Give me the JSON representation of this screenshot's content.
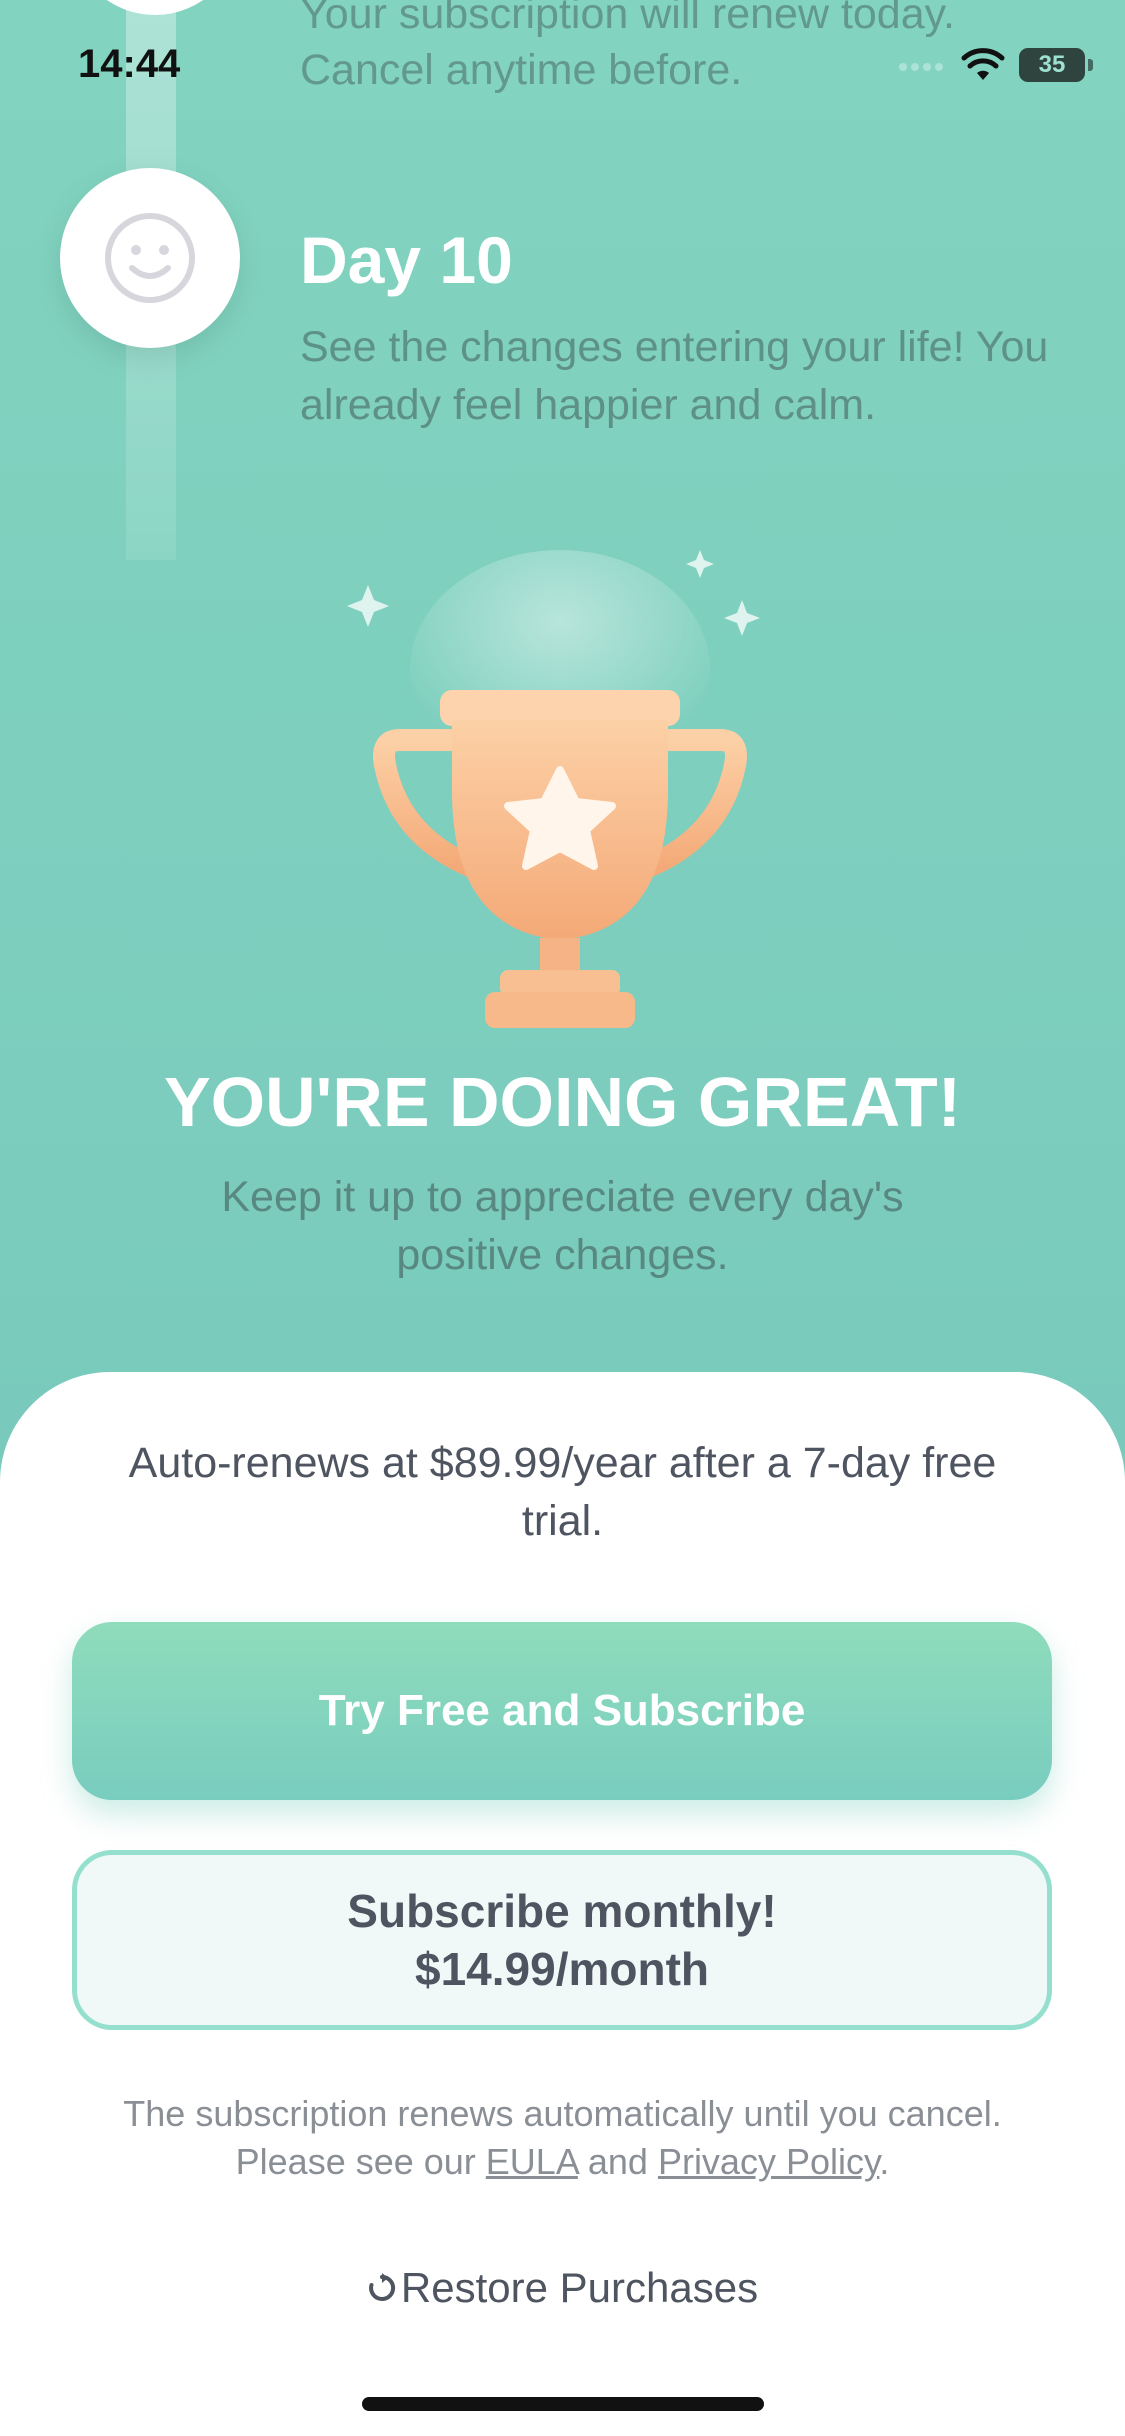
{
  "status_bar": {
    "time": "14:44",
    "battery": "35"
  },
  "timeline": {
    "previous_text": "Your subscription will renew today. Cancel anytime before.",
    "day_title": "Day 10",
    "day_description": "See the changes entering your life! You already feel happier and calm."
  },
  "hero": {
    "title": "YOU'RE DOING GREAT!",
    "subtitle": "Keep it up to appreciate every day's positive changes."
  },
  "offer": {
    "price_note": "Auto-renews at $89.99/year after a 7-day free trial.",
    "primary_button": "Try Free and Subscribe",
    "secondary_button_line1": "Subscribe monthly!",
    "secondary_button_line2": "$14.99/month",
    "legal_line1": "The subscription renews automatically until you cancel.",
    "legal_prefix": "Please see our ",
    "eula_link": "EULA",
    "legal_and": " and ",
    "privacy_link": "Privacy Policy",
    "legal_suffix": ".",
    "restore": "Restore Purchases"
  },
  "colors": {
    "accent": "#7ccdbd",
    "trophy": "#f7b98a"
  },
  "icons": [
    "smiley-icon",
    "trophy-icon",
    "sparkle-icon",
    "wifi-icon",
    "battery-icon",
    "restore-icon"
  ]
}
